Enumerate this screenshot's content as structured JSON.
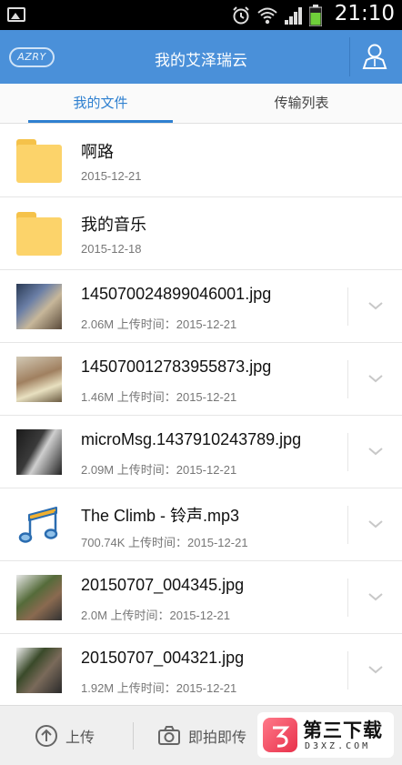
{
  "status_bar": {
    "time": "21:10",
    "icons": [
      "image-icon",
      "alarm-icon",
      "wifi-icon",
      "signal-icon",
      "battery-icon"
    ]
  },
  "header": {
    "logo_text": "AZRY",
    "title": "我的艾泽瑞云",
    "profile_icon": "user-icon"
  },
  "tabs": [
    {
      "label": "我的文件",
      "active": true
    },
    {
      "label": "传输列表",
      "active": false
    }
  ],
  "files": [
    {
      "type": "folder",
      "name": "啊路",
      "meta": "2015-12-21"
    },
    {
      "type": "folder",
      "name": "我的音乐",
      "meta": "2015-12-18"
    },
    {
      "type": "image",
      "name": "145070024899046001.jpg",
      "meta": "2.06M 上传时间：2015-12-21"
    },
    {
      "type": "image",
      "name": "145070012783955873.jpg",
      "meta": "1.46M 上传时间：2015-12-21"
    },
    {
      "type": "image",
      "name": "microMsg.1437910243789.jpg",
      "meta": "2.09M 上传时间：2015-12-21"
    },
    {
      "type": "audio",
      "name": "The Climb - 铃声.mp3",
      "meta": "700.74K 上传时间：2015-12-21"
    },
    {
      "type": "image",
      "name": "20150707_004345.jpg",
      "meta": "2.0M 上传时间：2015-12-21"
    },
    {
      "type": "image",
      "name": "20150707_004321.jpg",
      "meta": "1.92M 上传时间：2015-12-21"
    }
  ],
  "bottom_bar": {
    "upload_label": "上传",
    "camera_label": "即拍即传"
  },
  "watermark": {
    "title": "第三下载",
    "subtitle": "D3XZ.COM"
  },
  "colors": {
    "header_bg": "#4a90d9",
    "tab_active": "#2f80d0",
    "folder": "#fcd36a",
    "music_note": "#2a6cb0"
  }
}
